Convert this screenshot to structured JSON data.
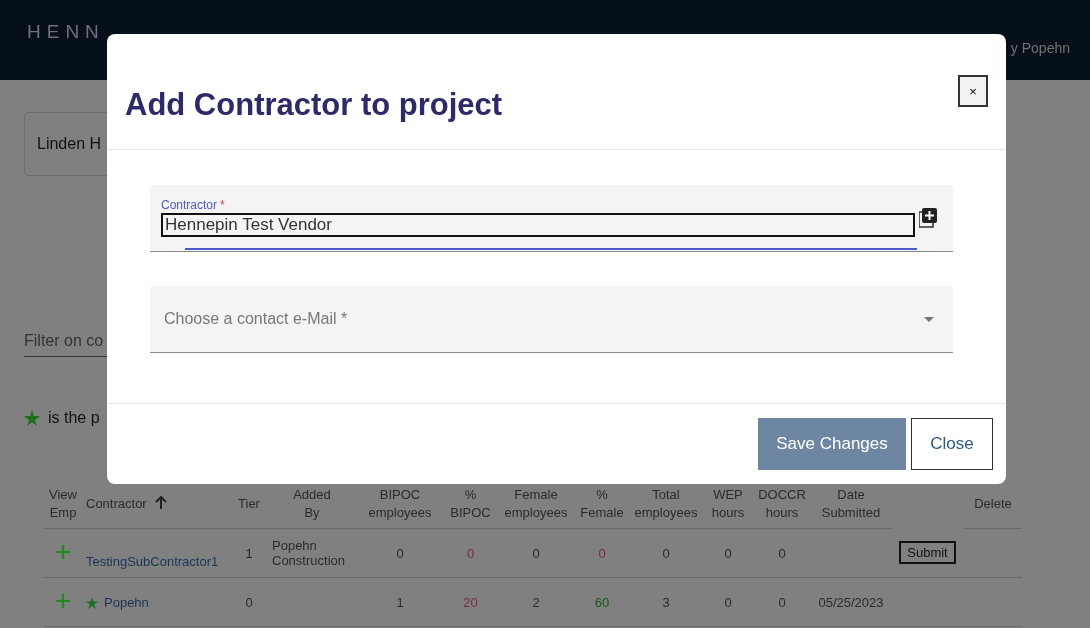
{
  "header": {
    "brand": "HENN",
    "user": "y Popehn"
  },
  "project_card": {
    "title": "Linden H"
  },
  "filter": {
    "placeholder": "Filter on co"
  },
  "legend": {
    "text": "is the p"
  },
  "table": {
    "columns": [
      {
        "label": "View Emp",
        "sorted": false
      },
      {
        "label": "Contractor",
        "sorted": true
      },
      {
        "label": "Tier",
        "sorted": false
      },
      {
        "label": "Added By",
        "sorted": false
      },
      {
        "label": "BIPOC employees",
        "sorted": false
      },
      {
        "label": "% BIPOC",
        "sorted": false
      },
      {
        "label": "Female employees",
        "sorted": false
      },
      {
        "label": "% Female",
        "sorted": false
      },
      {
        "label": "Total employees",
        "sorted": false
      },
      {
        "label": "WEP hours",
        "sorted": false
      },
      {
        "label": "DOCCR hours",
        "sorted": false
      },
      {
        "label": "Date Submitted",
        "sorted": false
      },
      {
        "sorted": false
      },
      {
        "label": "Delete",
        "sorted": false
      }
    ],
    "rows": [
      {
        "contractor": "TestingSubContractor1",
        "primary": false,
        "tier": "1",
        "added_by": "Popehn Construction",
        "bipoc": "0",
        "pct_bipoc": {
          "value": "0",
          "color": "#7a2a3a"
        },
        "female": "0",
        "pct_female": {
          "value": "0",
          "color": "#7a2a3a"
        },
        "total": "0",
        "wep": "0",
        "doccr": "0",
        "action": "Submit"
      },
      {
        "contractor": "Popehn",
        "primary": true,
        "tier": "0",
        "bipoc": "1",
        "pct_bipoc": {
          "value": "20",
          "color": "#7a2a3a"
        },
        "female": "2",
        "pct_female": {
          "value": "60",
          "color": "#135f13"
        },
        "total": "3",
        "wep": "0",
        "doccr": "0",
        "date": "05/25/2023"
      }
    ]
  },
  "modal": {
    "title": "Add Contractor to project",
    "close_label": "×",
    "contractor_field": {
      "label": "Contractor",
      "required_mark": "*",
      "value": "Hennepin Test Vendor",
      "focused": true
    },
    "email_field": {
      "placeholder": "Choose a contact e-Mail *"
    },
    "buttons": [
      {
        "label": "Save Changes",
        "kind": "primary"
      },
      {
        "label": "Close",
        "kind": "secondary"
      }
    ]
  }
}
